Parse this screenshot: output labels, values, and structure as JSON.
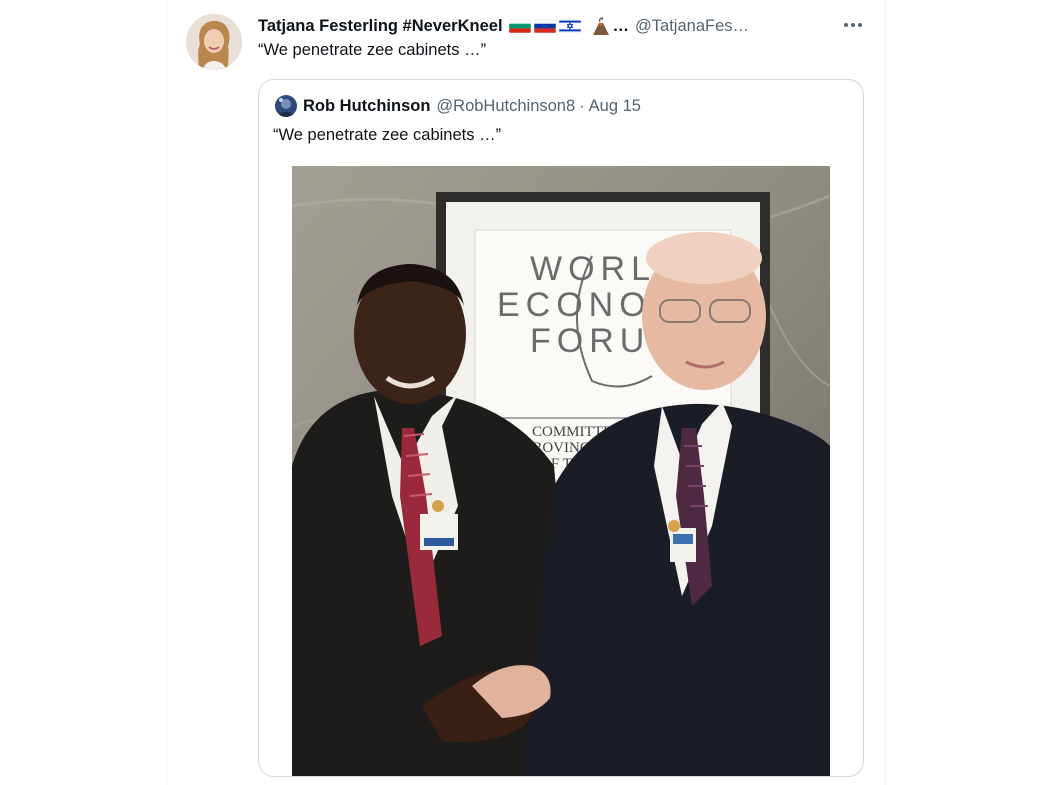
{
  "tweet": {
    "author_name": "Tatjana Festerling #NeverKneel",
    "flag_icons": [
      "bulgaria-flag-icon",
      "russia-flag-icon",
      "israel-flag-icon",
      "volcano-emoji-icon"
    ],
    "name_ellipsis": "…",
    "handle": "@TatjanaFes…",
    "text": "“We penetrate zee cabinets …”"
  },
  "quoted_tweet": {
    "author_name": "Rob Hutchinson",
    "handle": "@RobHutchinson8",
    "separator": "·",
    "date": "Aug 15",
    "text": "“We penetrate zee cabinets …”"
  },
  "photo": {
    "sign_lines": [
      "WORL",
      "ECONO",
      "FORU"
    ],
    "sign_sub": [
      "COMMITTE",
      "PROVING",
      "OF T"
    ]
  },
  "colors": {
    "text_primary": "#0f1419",
    "text_secondary": "#536471",
    "border": "#cfd9de"
  }
}
